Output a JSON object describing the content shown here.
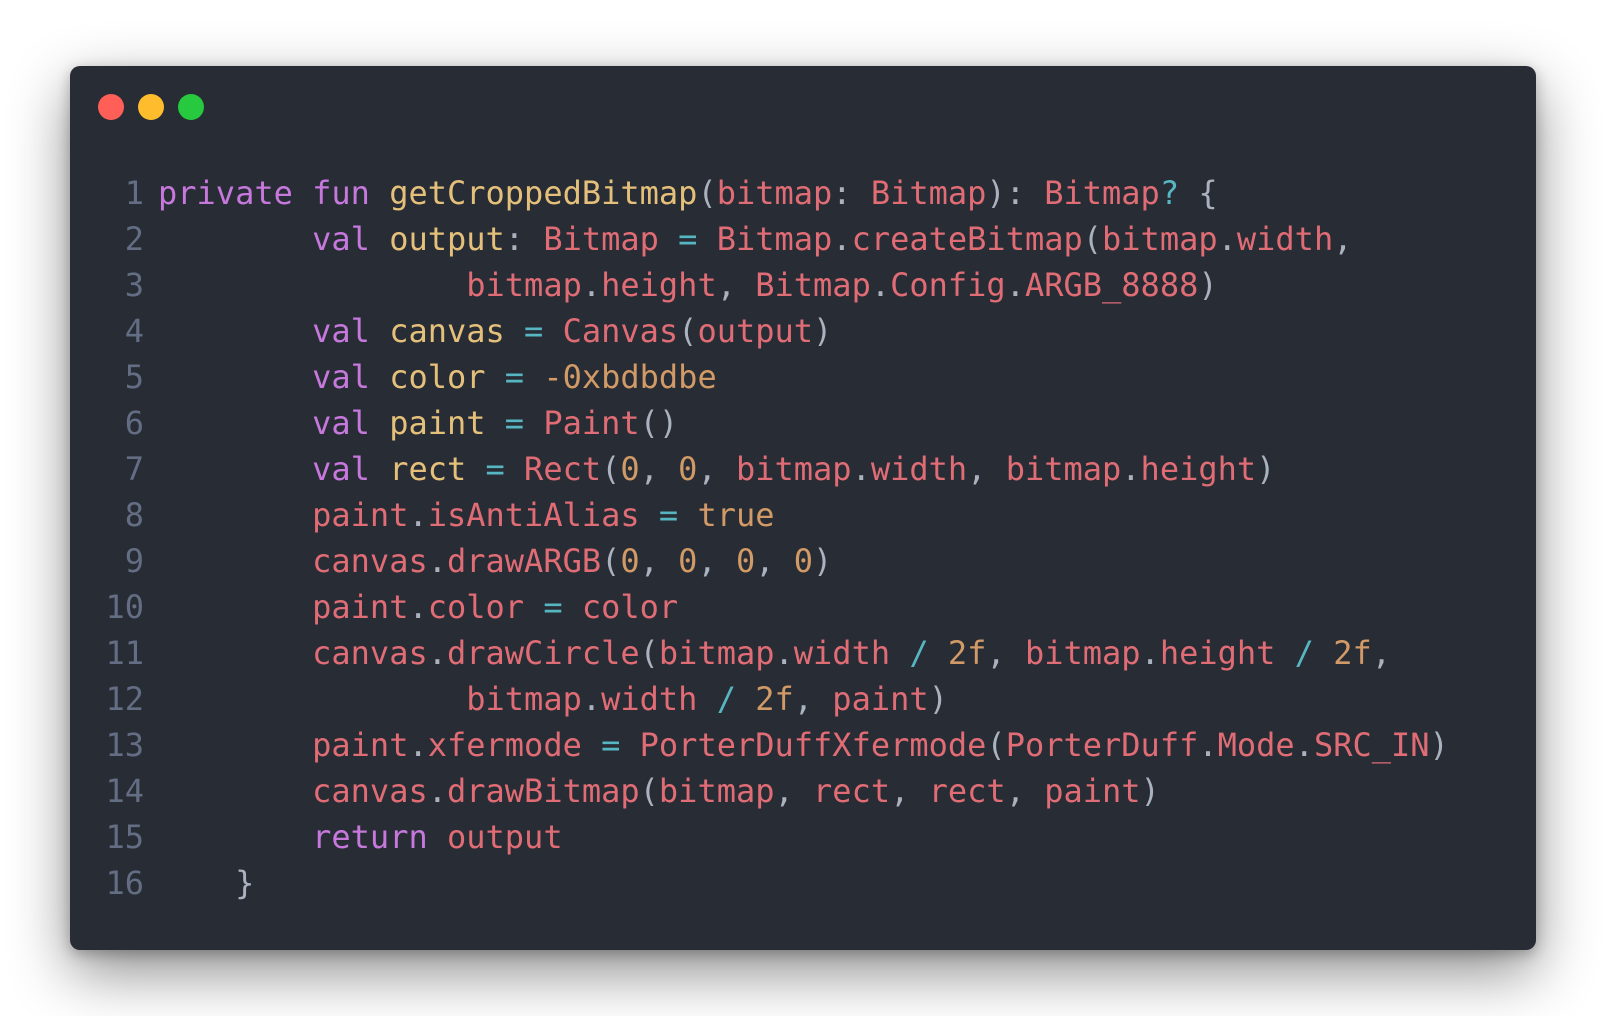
{
  "window": {
    "controls": [
      {
        "name": "close",
        "color": "#ff5f56"
      },
      {
        "name": "minimize",
        "color": "#ffbd2e"
      },
      {
        "name": "maximize",
        "color": "#27c93f"
      }
    ]
  },
  "theme": {
    "background": "#282c34",
    "line_number": "#636d83",
    "keyword": "#c678dd",
    "function": "#e5c07b",
    "identifier": "#e06c75",
    "number": "#d19a66",
    "operator": "#56b6c2",
    "punctuation": "#abb2bf"
  },
  "code": {
    "line_numbers": [
      "1",
      "2",
      "3",
      "4",
      "5",
      "6",
      "7",
      "8",
      "9",
      "10",
      "11",
      "12",
      "13",
      "14",
      "15",
      "16"
    ],
    "lines": [
      [
        [
          "kw",
          "private"
        ],
        [
          "pn",
          " "
        ],
        [
          "kw",
          "fun"
        ],
        [
          "pn",
          " "
        ],
        [
          "fn",
          "getCroppedBitmap"
        ],
        [
          "pn",
          "("
        ],
        [
          "id",
          "bitmap"
        ],
        [
          "pn",
          ": "
        ],
        [
          "id",
          "Bitmap"
        ],
        [
          "pn",
          "): "
        ],
        [
          "id",
          "Bitmap"
        ],
        [
          "op",
          "?"
        ],
        [
          "pn",
          " {"
        ]
      ],
      [
        [
          "pn",
          "        "
        ],
        [
          "kw",
          "val"
        ],
        [
          "pn",
          " "
        ],
        [
          "fn",
          "output"
        ],
        [
          "pn",
          ": "
        ],
        [
          "id",
          "Bitmap"
        ],
        [
          "pn",
          " "
        ],
        [
          "op",
          "="
        ],
        [
          "pn",
          " "
        ],
        [
          "id",
          "Bitmap"
        ],
        [
          "pn",
          "."
        ],
        [
          "id",
          "createBitmap"
        ],
        [
          "pn",
          "("
        ],
        [
          "id",
          "bitmap"
        ],
        [
          "pn",
          "."
        ],
        [
          "id",
          "width"
        ],
        [
          "pn",
          ","
        ]
      ],
      [
        [
          "pn",
          "                "
        ],
        [
          "id",
          "bitmap"
        ],
        [
          "pn",
          "."
        ],
        [
          "id",
          "height"
        ],
        [
          "pn",
          ", "
        ],
        [
          "id",
          "Bitmap"
        ],
        [
          "pn",
          "."
        ],
        [
          "id",
          "Config"
        ],
        [
          "pn",
          "."
        ],
        [
          "id",
          "ARGB_8888"
        ],
        [
          "pn",
          ")"
        ]
      ],
      [
        [
          "pn",
          "        "
        ],
        [
          "kw",
          "val"
        ],
        [
          "pn",
          " "
        ],
        [
          "fn",
          "canvas"
        ],
        [
          "pn",
          " "
        ],
        [
          "op",
          "="
        ],
        [
          "pn",
          " "
        ],
        [
          "id",
          "Canvas"
        ],
        [
          "pn",
          "("
        ],
        [
          "id",
          "output"
        ],
        [
          "pn",
          ")"
        ]
      ],
      [
        [
          "pn",
          "        "
        ],
        [
          "kw",
          "val"
        ],
        [
          "pn",
          " "
        ],
        [
          "fn",
          "color"
        ],
        [
          "pn",
          " "
        ],
        [
          "op",
          "="
        ],
        [
          "pn",
          " "
        ],
        [
          "num",
          "-0xbdbdbe"
        ]
      ],
      [
        [
          "pn",
          "        "
        ],
        [
          "kw",
          "val"
        ],
        [
          "pn",
          " "
        ],
        [
          "fn",
          "paint"
        ],
        [
          "pn",
          " "
        ],
        [
          "op",
          "="
        ],
        [
          "pn",
          " "
        ],
        [
          "id",
          "Paint"
        ],
        [
          "pn",
          "()"
        ]
      ],
      [
        [
          "pn",
          "        "
        ],
        [
          "kw",
          "val"
        ],
        [
          "pn",
          " "
        ],
        [
          "fn",
          "rect"
        ],
        [
          "pn",
          " "
        ],
        [
          "op",
          "="
        ],
        [
          "pn",
          " "
        ],
        [
          "id",
          "Rect"
        ],
        [
          "pn",
          "("
        ],
        [
          "num",
          "0"
        ],
        [
          "pn",
          ", "
        ],
        [
          "num",
          "0"
        ],
        [
          "pn",
          ", "
        ],
        [
          "id",
          "bitmap"
        ],
        [
          "pn",
          "."
        ],
        [
          "id",
          "width"
        ],
        [
          "pn",
          ", "
        ],
        [
          "id",
          "bitmap"
        ],
        [
          "pn",
          "."
        ],
        [
          "id",
          "height"
        ],
        [
          "pn",
          ")"
        ]
      ],
      [
        [
          "pn",
          "        "
        ],
        [
          "id",
          "paint"
        ],
        [
          "pn",
          "."
        ],
        [
          "id",
          "isAntiAlias"
        ],
        [
          "pn",
          " "
        ],
        [
          "op",
          "="
        ],
        [
          "pn",
          " "
        ],
        [
          "num",
          "true"
        ]
      ],
      [
        [
          "pn",
          "        "
        ],
        [
          "id",
          "canvas"
        ],
        [
          "pn",
          "."
        ],
        [
          "id",
          "drawARGB"
        ],
        [
          "pn",
          "("
        ],
        [
          "num",
          "0"
        ],
        [
          "pn",
          ", "
        ],
        [
          "num",
          "0"
        ],
        [
          "pn",
          ", "
        ],
        [
          "num",
          "0"
        ],
        [
          "pn",
          ", "
        ],
        [
          "num",
          "0"
        ],
        [
          "pn",
          ")"
        ]
      ],
      [
        [
          "pn",
          "        "
        ],
        [
          "id",
          "paint"
        ],
        [
          "pn",
          "."
        ],
        [
          "id",
          "color"
        ],
        [
          "pn",
          " "
        ],
        [
          "op",
          "="
        ],
        [
          "pn",
          " "
        ],
        [
          "id",
          "color"
        ]
      ],
      [
        [
          "pn",
          "        "
        ],
        [
          "id",
          "canvas"
        ],
        [
          "pn",
          "."
        ],
        [
          "id",
          "drawCircle"
        ],
        [
          "pn",
          "("
        ],
        [
          "id",
          "bitmap"
        ],
        [
          "pn",
          "."
        ],
        [
          "id",
          "width"
        ],
        [
          "pn",
          " "
        ],
        [
          "op",
          "/"
        ],
        [
          "pn",
          " "
        ],
        [
          "num",
          "2f"
        ],
        [
          "pn",
          ", "
        ],
        [
          "id",
          "bitmap"
        ],
        [
          "pn",
          "."
        ],
        [
          "id",
          "height"
        ],
        [
          "pn",
          " "
        ],
        [
          "op",
          "/"
        ],
        [
          "pn",
          " "
        ],
        [
          "num",
          "2f"
        ],
        [
          "pn",
          ","
        ]
      ],
      [
        [
          "pn",
          "                "
        ],
        [
          "id",
          "bitmap"
        ],
        [
          "pn",
          "."
        ],
        [
          "id",
          "width"
        ],
        [
          "pn",
          " "
        ],
        [
          "op",
          "/"
        ],
        [
          "pn",
          " "
        ],
        [
          "num",
          "2f"
        ],
        [
          "pn",
          ", "
        ],
        [
          "id",
          "paint"
        ],
        [
          "pn",
          ")"
        ]
      ],
      [
        [
          "pn",
          "        "
        ],
        [
          "id",
          "paint"
        ],
        [
          "pn",
          "."
        ],
        [
          "id",
          "xfermode"
        ],
        [
          "pn",
          " "
        ],
        [
          "op",
          "="
        ],
        [
          "pn",
          " "
        ],
        [
          "id",
          "PorterDuffXfermode"
        ],
        [
          "pn",
          "("
        ],
        [
          "id",
          "PorterDuff"
        ],
        [
          "pn",
          "."
        ],
        [
          "id",
          "Mode"
        ],
        [
          "pn",
          "."
        ],
        [
          "id",
          "SRC_IN"
        ],
        [
          "pn",
          ")"
        ]
      ],
      [
        [
          "pn",
          "        "
        ],
        [
          "id",
          "canvas"
        ],
        [
          "pn",
          "."
        ],
        [
          "id",
          "drawBitmap"
        ],
        [
          "pn",
          "("
        ],
        [
          "id",
          "bitmap"
        ],
        [
          "pn",
          ", "
        ],
        [
          "id",
          "rect"
        ],
        [
          "pn",
          ", "
        ],
        [
          "id",
          "rect"
        ],
        [
          "pn",
          ", "
        ],
        [
          "id",
          "paint"
        ],
        [
          "pn",
          ")"
        ]
      ],
      [
        [
          "pn",
          "        "
        ],
        [
          "kw",
          "return"
        ],
        [
          "pn",
          " "
        ],
        [
          "id",
          "output"
        ]
      ],
      [
        [
          "pn",
          "    }"
        ]
      ]
    ]
  }
}
